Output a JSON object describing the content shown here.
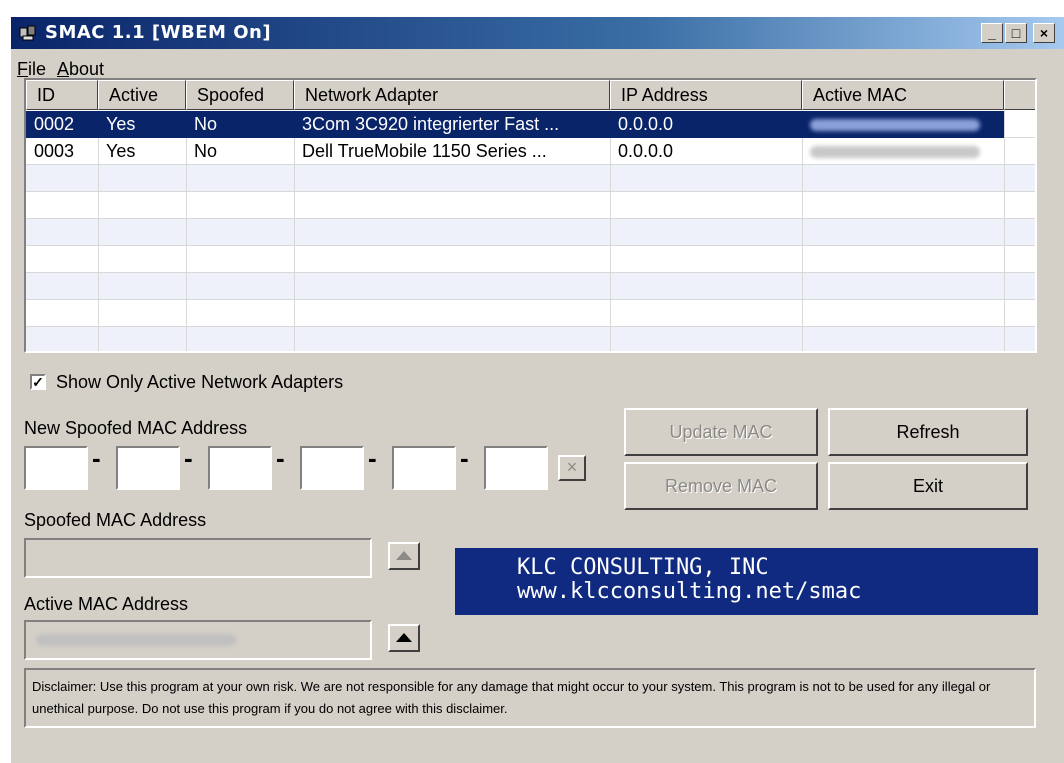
{
  "window": {
    "title": "SMAC 1.1  [WBEM On]",
    "buttons": {
      "minimize": "_",
      "maximize": "□",
      "close": "×"
    }
  },
  "menu": {
    "file": {
      "underline": "F",
      "rest": "ile"
    },
    "about": {
      "underline": "A",
      "rest": "bout"
    }
  },
  "table": {
    "columns": [
      "ID",
      "Active",
      "Spoofed",
      "Network Adapter",
      "IP Address",
      "Active MAC"
    ],
    "rows": [
      {
        "id": "0002",
        "active": "Yes",
        "spoofed": "No",
        "adapter": "3Com 3C920 integrierter Fast ...",
        "ip": "0.0.0.0",
        "selected": true
      },
      {
        "id": "0003",
        "active": "Yes",
        "spoofed": "No",
        "adapter": "Dell TrueMobile 1150 Series ...",
        "ip": "0.0.0.0",
        "selected": false
      }
    ]
  },
  "options": {
    "show_active_label": "Show Only Active Network Adapters",
    "show_active_checked": true
  },
  "spoof": {
    "new_mac_label": "New Spoofed MAC Address",
    "octets": [
      "",
      "",
      "",
      "",
      "",
      ""
    ],
    "separator": "-",
    "clear_button": "×",
    "spoofed_mac_label": "Spoofed MAC Address",
    "spoofed_mac_value": "",
    "active_mac_label": "Active MAC Address"
  },
  "buttons": {
    "update": "Update MAC",
    "refresh": "Refresh",
    "remove": "Remove MAC",
    "exit": "Exit"
  },
  "banner": {
    "line1": "KLC CONSULTING, INC",
    "line2": "www.klcconsulting.net/smac"
  },
  "disclaimer": "Disclaimer: Use this program at your own risk.  We are not responsible for any damage that might occur to your system.  This program is not to be used for any illegal or unethical purpose.  Do not use this program if you do not agree with this disclaimer.",
  "colors": {
    "titlebar_start": "#0a246a",
    "selection": "#0a246a",
    "banner_bg": "#0f2a80",
    "window_bg": "#d4d0c8"
  }
}
